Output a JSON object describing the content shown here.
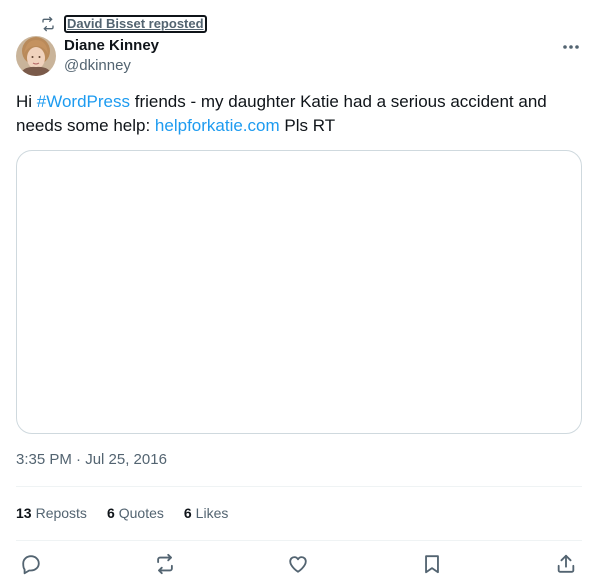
{
  "repost": {
    "icon": "repost-icon",
    "label": "David Bisset reposted"
  },
  "author": {
    "name": "Diane Kinney",
    "handle": "@dkinney",
    "avatar_icon": "avatar-photo"
  },
  "more_icon": "more-horizontal-icon",
  "tweet": {
    "text_before_hashtag": "Hi ",
    "hashtag": "#WordPress",
    "text_middle": " friends - my daughter Katie had a serious accident and needs some help: ",
    "link": "helpforkatie.com",
    "text_after_link": " Pls RT"
  },
  "timestamp": "3:35 PM · Jul 25, 2016",
  "stats": {
    "reposts_count": "13",
    "reposts_label": "Reposts",
    "quotes_count": "6",
    "quotes_label": "Quotes",
    "likes_count": "6",
    "likes_label": "Likes"
  },
  "actions": [
    "reply-icon",
    "repost-icon",
    "like-icon",
    "bookmark-icon",
    "share-icon"
  ],
  "colors": {
    "text": "#0f1419",
    "secondary": "#536471",
    "link": "#1d9bf0",
    "border": "#cfd9de",
    "divider": "#eff3f4"
  }
}
